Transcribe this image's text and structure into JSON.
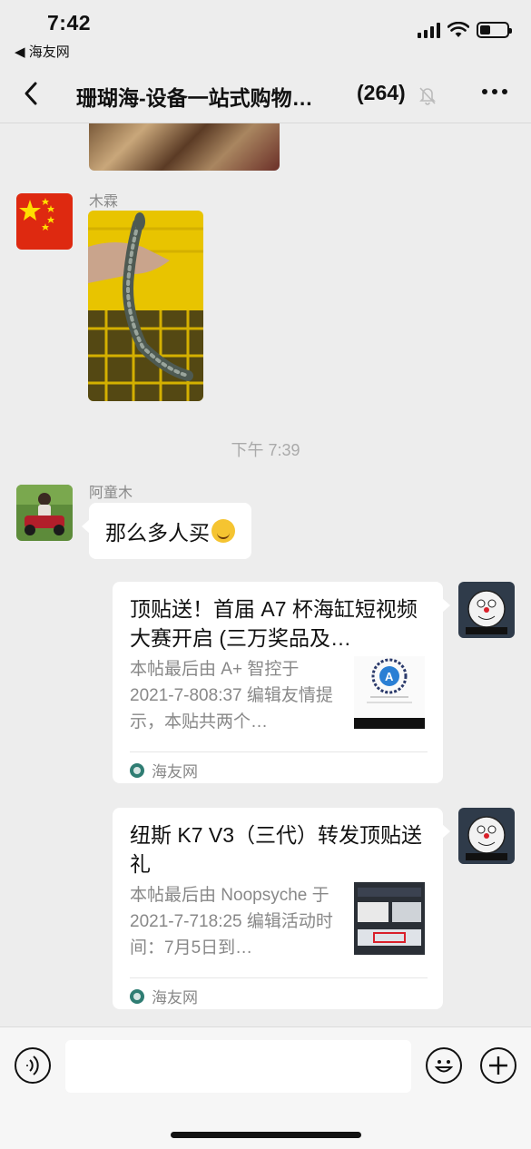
{
  "status_bar": {
    "time": "7:42",
    "back_app": "◀ 海友网",
    "battery_level": 0.4
  },
  "header": {
    "back_icon": "chevron-left-icon",
    "title": "珊瑚海-设备一站式购物…",
    "member_count": "(264)",
    "mute_icon": "bell-slash-icon",
    "more_icon": "ellipsis-icon"
  },
  "messages": [
    {
      "type": "image",
      "sender": "木霖",
      "avatar": "china-flag-avatar",
      "image": "baby-crocodile-photo"
    },
    {
      "type": "timestamp",
      "text": "下午 7:39"
    },
    {
      "type": "text",
      "sender": "阿童木",
      "avatar": "child-rc-car-avatar",
      "text": "那么多人买",
      "emoji": "laughing-crying-emoji"
    },
    {
      "type": "link-card",
      "avatar": "doraemon-avatar",
      "title": "顶贴送！首届 A7 杯海缸短视频大赛开启 (三万奖品及…",
      "description": "本帖最后由 A+ 智控于 2021-7-808:37 编辑友情提示，本贴共两个…",
      "thumb": "qr-code-thumbnail",
      "source": "海友网"
    },
    {
      "type": "link-card",
      "avatar": "doraemon-avatar",
      "title": "纽斯 K7 V3（三代）转发顶贴送礼",
      "description": "本帖最后由 Noopsyche 于 2021-7-718:25 编辑活动时间：7月5日到…",
      "thumb": "k7-product-thumbnail",
      "source": "海友网"
    }
  ],
  "input_bar": {
    "voice_icon": "voice-icon",
    "placeholder": "",
    "emoji_icon": "emoji-icon",
    "plus_icon": "plus-icon"
  },
  "colors": {
    "background": "#ededed",
    "bubble": "#ffffff",
    "meta_text": "#888888",
    "source_icon": "#2f7d73"
  }
}
